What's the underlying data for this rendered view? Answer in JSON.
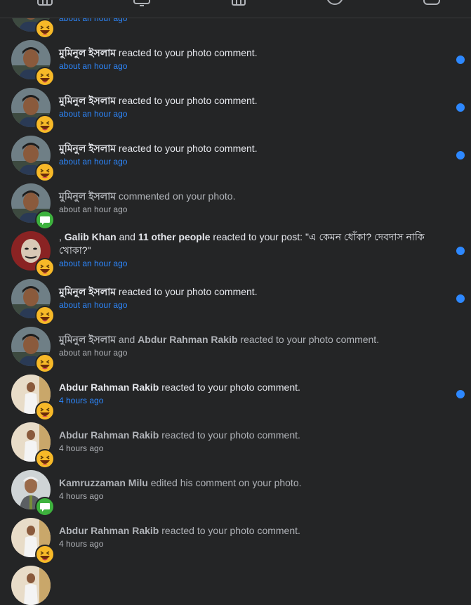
{
  "nav": {
    "icons": [
      "home-icon",
      "watch-icon",
      "marketplace-icon",
      "groups-icon",
      "gaming-icon"
    ]
  },
  "colors": {
    "accent": "#2d88ff",
    "background": "#242526",
    "reaction": "#f7b928",
    "comment_badge": "#3eb23e"
  },
  "notifications": [
    {
      "name": "",
      "action": "",
      "time": "about an hour ago",
      "unread": true,
      "badge": "haha-reaction-icon",
      "avatar": "young-man"
    },
    {
      "name": "মুমিনুল ইসলাম",
      "action": " reacted to your photo comment.",
      "time": "about an hour ago",
      "unread": true,
      "badge": "haha-reaction-icon",
      "avatar": "young-man"
    },
    {
      "name": "মুমিনুল ইসলাম",
      "action": " reacted to your photo comment.",
      "time": "about an hour ago",
      "unread": true,
      "badge": "haha-reaction-icon",
      "avatar": "young-man"
    },
    {
      "name": "মুমিনুল ইসলাম",
      "action": " reacted to your photo comment.",
      "time": "about an hour ago",
      "unread": true,
      "badge": "haha-reaction-icon",
      "avatar": "young-man"
    },
    {
      "name": "মুমিনুল ইসলাম",
      "action": " commented on your photo.",
      "time": "about an hour ago",
      "unread": false,
      "badge": "comment-icon",
      "avatar": "young-man"
    },
    {
      "name": "",
      "prefix": " , ",
      "name1": "Galib Khan",
      "mid": " and ",
      "name2": "11 other people",
      "action": " reacted to your post: \"এ কেমন ধোঁকা? দেবদাস নাকি খোকা?\"",
      "time": "about an hour ago",
      "unread": true,
      "badge": "haha-reaction-icon",
      "avatar": "mask"
    },
    {
      "name": "মুমিনুল ইসলাম",
      "action": " reacted to your photo comment.",
      "time": "about an hour ago",
      "unread": true,
      "badge": "haha-reaction-icon",
      "avatar": "young-man"
    },
    {
      "name": "মুমিনুল ইসলাম",
      "mid": " and ",
      "name2": "Abdur Rahman Rakib",
      "action": " reacted to your photo comment.",
      "time": "about an hour ago",
      "unread": false,
      "badge": "haha-reaction-icon",
      "avatar": "young-man"
    },
    {
      "name": "Abdur Rahman Rakib",
      "action": " reacted to your photo comment.",
      "time": "4 hours ago",
      "unread": true,
      "badge": "haha-reaction-icon",
      "avatar": "white-shirt"
    },
    {
      "name": "Abdur Rahman Rakib",
      "action": " reacted to your photo comment.",
      "time": "4 hours ago",
      "unread": false,
      "badge": "haha-reaction-icon",
      "avatar": "white-shirt"
    },
    {
      "name": "Kamruzzaman Milu",
      "action": " edited his comment on your photo.",
      "time": "4 hours ago",
      "unread": false,
      "badge": "comment-icon",
      "avatar": "older-man"
    },
    {
      "name": "Abdur Rahman Rakib",
      "action": " reacted to your photo comment.",
      "time": "4 hours ago",
      "unread": false,
      "badge": "haha-reaction-icon",
      "avatar": "white-shirt"
    }
  ]
}
